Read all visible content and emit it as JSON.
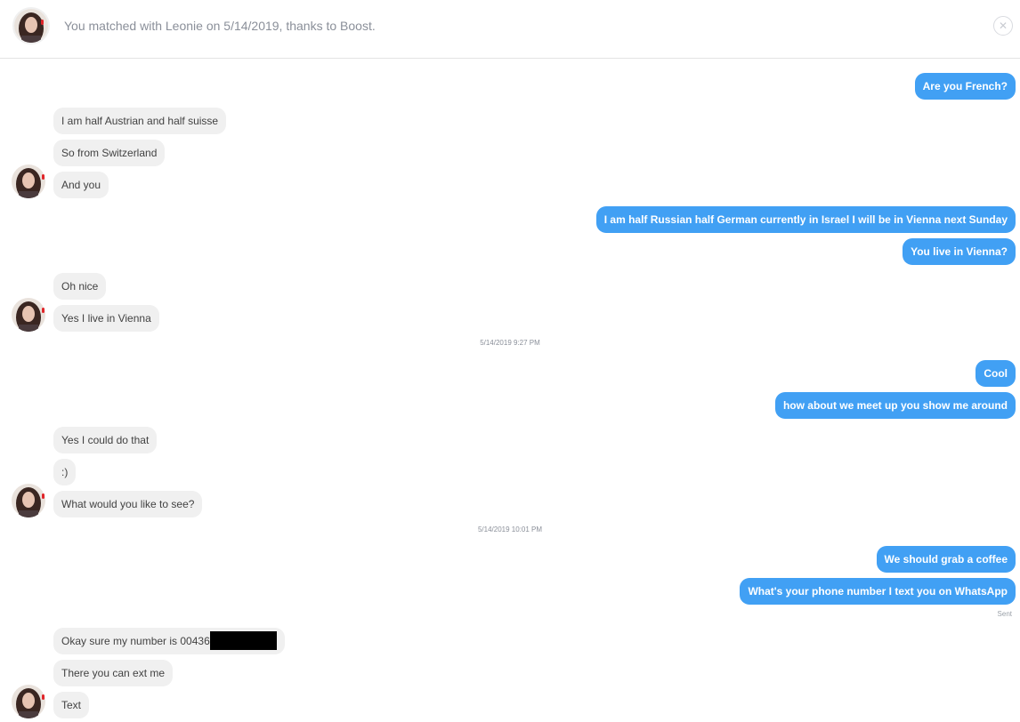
{
  "header": {
    "match_text": "You matched with Leonie on 5/14/2019, thanks to Boost.",
    "close_icon": "close-circle-icon"
  },
  "messages": {
    "m1": "Are you French?",
    "m2": "I am half Austrian and half suisse",
    "m3": "So from Switzerland",
    "m4": "And you",
    "m5": "I am half Russian half German currently in Israel I will be in Vienna next Sunday",
    "m6": "You live in Vienna?",
    "m7": "Oh nice",
    "m8": "Yes I live in Vienna",
    "ts1": "5/14/2019 9:27 PM",
    "m9": "Cool",
    "m10": "how about we meet up you show me around",
    "m11": "Yes I could do that",
    "m12": ":)",
    "m13": "What would you like to see?",
    "ts2": "5/14/2019 10:01 PM",
    "m14": "We should grab a coffee",
    "m15": "What's your phone number I text you on WhatsApp",
    "sent": "Sent",
    "m16": "Okay sure my number is 00436",
    "m17": "There you can ext me",
    "m18": "Text"
  },
  "colors": {
    "outgoing": "#41a0f4",
    "incoming": "#f0f0f0"
  }
}
